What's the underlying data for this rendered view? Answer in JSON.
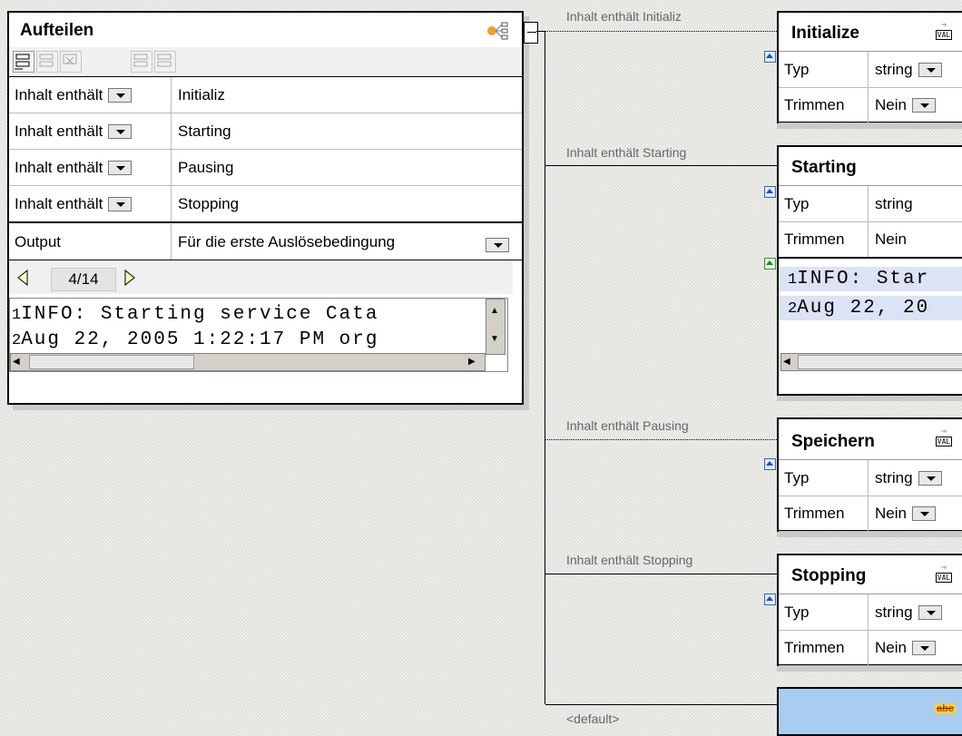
{
  "split_panel": {
    "title": "Aufteilen",
    "conditions": [
      {
        "operator": "Inhalt enthält",
        "value": "Initializ"
      },
      {
        "operator": "Inhalt enthält",
        "value": "Starting"
      },
      {
        "operator": "Inhalt enthält",
        "value": "Pausing"
      },
      {
        "operator": "Inhalt enthält",
        "value": "Stopping"
      }
    ],
    "output_label": "Output",
    "output_value": "Für die erste Auslösebedingung",
    "pager": "4/14",
    "preview_lines": [
      {
        "num": "1",
        "text": "INFO: Starting service Cata"
      },
      {
        "num": "2",
        "text": "Aug 22, 2005 1:22:17 PM org"
      }
    ]
  },
  "connector_labels": {
    "initialize": "Inhalt enthält Initializ",
    "starting": "Inhalt enthält Starting",
    "pausing": "Inhalt enthält Pausing",
    "stopping": "Inhalt enthält Stopping",
    "default": "<default>"
  },
  "nodes": {
    "initialize": {
      "title": "Initialize",
      "typ_label": "Typ",
      "typ_value": "string",
      "trim_label": "Trimmen",
      "trim_value": "Nein"
    },
    "starting": {
      "title": "Starting",
      "typ_label": "Typ",
      "typ_value": "string",
      "trim_label": "Trimmen",
      "trim_value": "Nein",
      "preview_lines": [
        {
          "num": "1",
          "text": "INFO: Star"
        },
        {
          "num": "2",
          "text": "Aug 22, 20"
        }
      ]
    },
    "speichern": {
      "title": "Speichern",
      "typ_label": "Typ",
      "typ_value": "string",
      "trim_label": "Trimmen",
      "trim_value": "Nein"
    },
    "stopping": {
      "title": "Stopping",
      "typ_label": "Typ",
      "typ_value": "string",
      "trim_label": "Trimmen",
      "trim_value": "Nein"
    }
  },
  "icons": {
    "value_icon_text": "VAL",
    "abc_icon_text": "abc"
  },
  "colors": {
    "canvas": "#e2e2de",
    "highlight_blue": "#dde3f6",
    "default_box": "#a9cdf0"
  }
}
